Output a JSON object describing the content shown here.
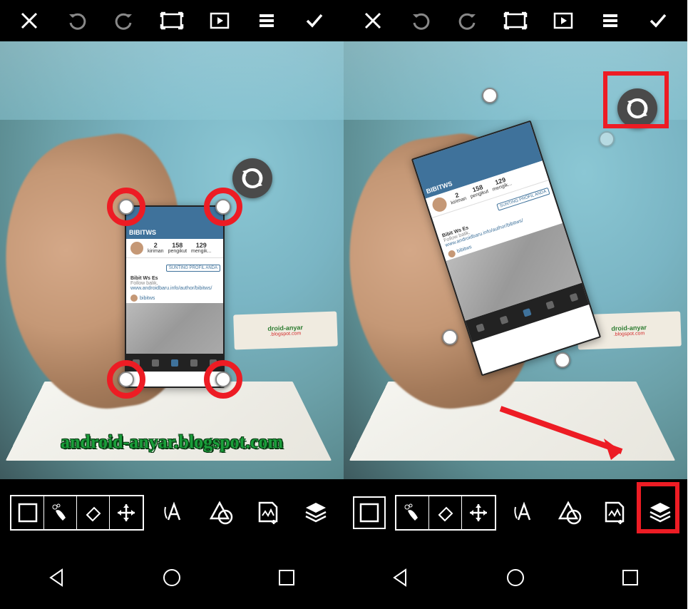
{
  "panels": [
    {
      "overlay_phone": {
        "header": "BIBITWS",
        "stats": [
          {
            "num": "2",
            "label": "kiriman"
          },
          {
            "num": "158",
            "label": "pengikut"
          },
          {
            "num": "129",
            "label": "mengik..."
          }
        ],
        "edit_btn": "SUNTING PROFIL ANDA",
        "bio_name": "Bibit Ws Es",
        "bio_follow": "Follow balik,",
        "bio_link": "www.androidbaru.info/author/bibitws/",
        "user_tag": "bibitws"
      },
      "watermark": "android-anyar.blogspot.com",
      "paper_label_top": "droid-anyar",
      "paper_label_bottom": ".blogspot.com"
    },
    {
      "overlay_phone": {
        "header": "BIBITWS",
        "stats": [
          {
            "num": "2",
            "label": "kiriman"
          },
          {
            "num": "158",
            "label": "pengikut"
          },
          {
            "num": "129",
            "label": "mengik..."
          }
        ],
        "edit_btn": "SUNTING PROFIL ANDA",
        "bio_name": "Bibit Ws Es",
        "bio_follow": "Follow balik,",
        "bio_link": "www.androidbaru.info/author/bibitws/",
        "user_tag": "bibitws"
      },
      "paper_label_top": "droid-anyar",
      "paper_label_bottom": ".blogspot.com"
    }
  ]
}
